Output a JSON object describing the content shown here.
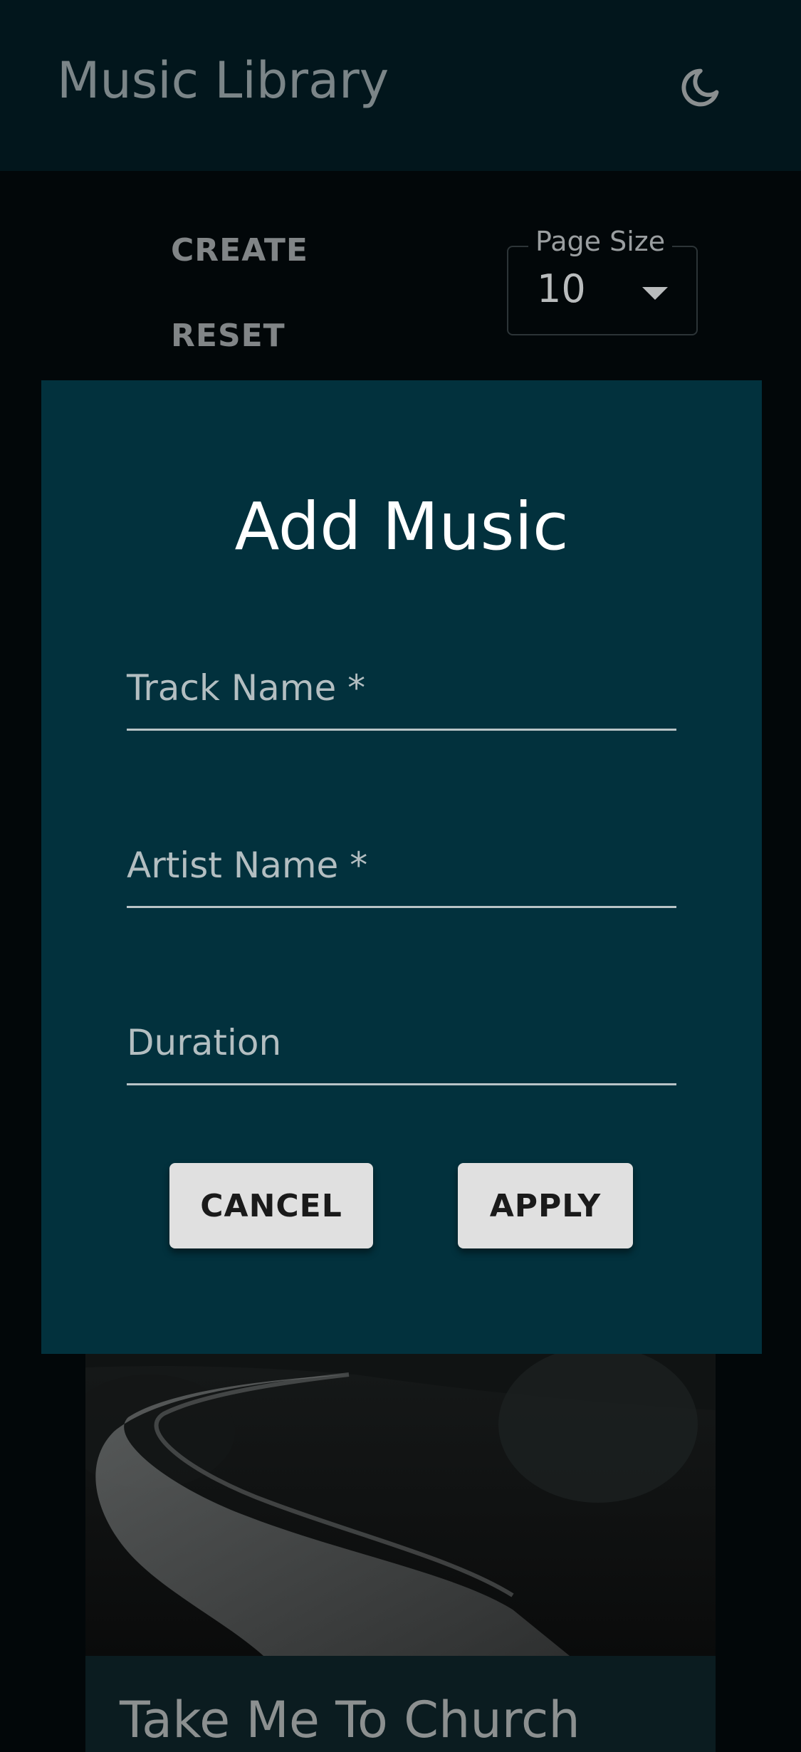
{
  "header": {
    "title": "Music Library",
    "theme_icon": "moon-icon"
  },
  "toolbar": {
    "create_label": "CREATE",
    "reset_label": "RESET",
    "page_size": {
      "label": "Page Size",
      "value": "10",
      "icon": "caret-down-icon"
    }
  },
  "dialog": {
    "title": "Add Music",
    "fields": [
      {
        "label": "Track Name *",
        "value": ""
      },
      {
        "label": "Artist Name *",
        "value": ""
      },
      {
        "label": "Duration",
        "value": ""
      }
    ],
    "cancel_label": "CANCEL",
    "apply_label": "APPLY"
  },
  "card": {
    "title": "Take Me To Church"
  },
  "colors": {
    "app_bar": "#02161c",
    "background": "#020709",
    "dialog": "#02313d",
    "button": "#e0e0e0"
  }
}
